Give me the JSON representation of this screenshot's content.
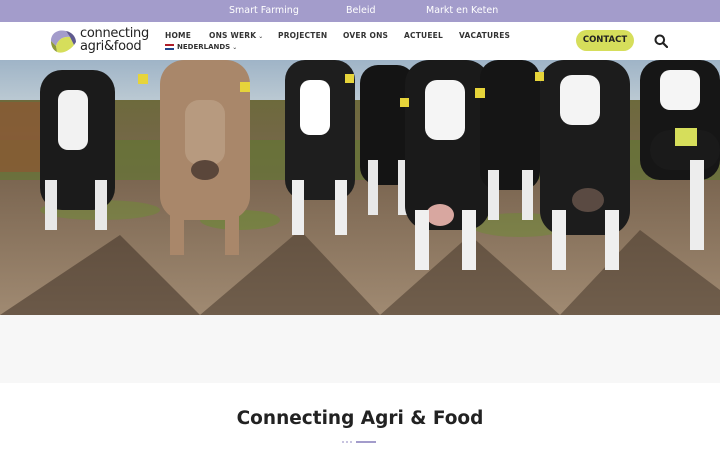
{
  "topbar": {
    "links": [
      "Smart Farming",
      "Beleid",
      "Markt en Keten"
    ],
    "background": "#a39ccb"
  },
  "logo": {
    "line1": "connecting",
    "line2": "agri&food"
  },
  "nav": {
    "items": [
      "HOME",
      "ONS WERK",
      "PROJECTEN",
      "OVER ONS",
      "ACTUEEL",
      "VACATURES"
    ],
    "language": "NEDERLANDS",
    "contact_label": "CONTACT",
    "contact_color": "#d6de5b"
  },
  "icons": {
    "search": "search-icon",
    "caret": "chevron-down-icon",
    "flag": "nl-flag-icon"
  },
  "hero": {
    "image": "herd of black-and-white and brown cows with yellow ear tags standing in a muddy field"
  },
  "main": {
    "heading": "Connecting Agri & Food"
  }
}
